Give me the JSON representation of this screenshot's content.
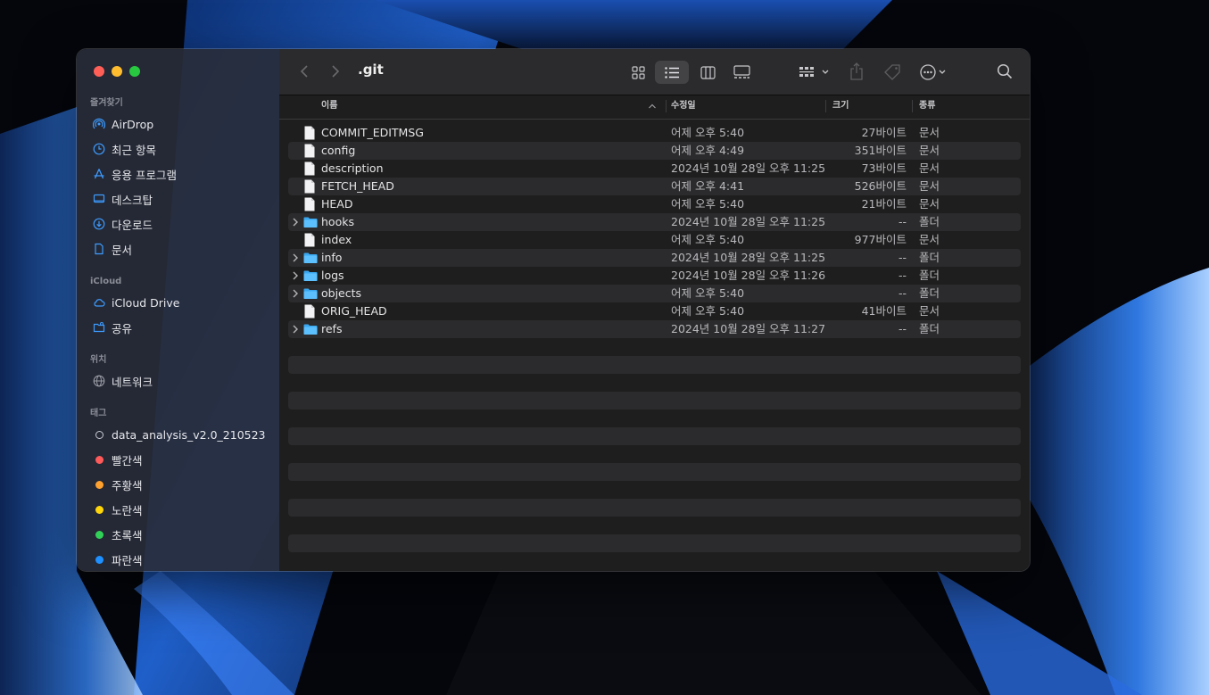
{
  "window": {
    "title": ".git"
  },
  "sidebar": {
    "favorites": {
      "heading": "즐겨찾기",
      "items": [
        {
          "label": "AirDrop",
          "icon": "airdrop-icon"
        },
        {
          "label": "최근 항목",
          "icon": "clock-icon"
        },
        {
          "label": "응용 프로그램",
          "icon": "applications-icon"
        },
        {
          "label": "데스크탑",
          "icon": "desktop-icon"
        },
        {
          "label": "다운로드",
          "icon": "download-icon"
        },
        {
          "label": "문서",
          "icon": "document-icon"
        }
      ]
    },
    "icloud": {
      "heading": "iCloud",
      "items": [
        {
          "label": "iCloud Drive",
          "icon": "cloud-icon"
        },
        {
          "label": "공유",
          "icon": "shared-folder-icon"
        }
      ]
    },
    "locations": {
      "heading": "위치",
      "items": [
        {
          "label": "네트워크",
          "icon": "globe-icon"
        }
      ]
    },
    "tags": {
      "heading": "태그",
      "items": [
        {
          "label": "data_analysis_v2.0_210523",
          "color": "none"
        },
        {
          "label": "빨간색",
          "color": "#ff5a5a"
        },
        {
          "label": "주황색",
          "color": "#ffa12e"
        },
        {
          "label": "노란색",
          "color": "#ffd60a"
        },
        {
          "label": "초록색",
          "color": "#31d158"
        },
        {
          "label": "파란색",
          "color": "#1e90ff"
        }
      ]
    }
  },
  "columns": {
    "name": "이름",
    "date": "수정일",
    "size": "크기",
    "kind": "종류"
  },
  "files": [
    {
      "name": "COMMIT_EDITMSG",
      "date": "어제 오후 5:40",
      "size": "27바이트",
      "kind": "문서",
      "folder": false
    },
    {
      "name": "config",
      "date": "어제 오후 4:49",
      "size": "351바이트",
      "kind": "문서",
      "folder": false
    },
    {
      "name": "description",
      "date": "2024년 10월 28일 오후 11:25",
      "size": "73바이트",
      "kind": "문서",
      "folder": false
    },
    {
      "name": "FETCH_HEAD",
      "date": "어제 오후 4:41",
      "size": "526바이트",
      "kind": "문서",
      "folder": false
    },
    {
      "name": "HEAD",
      "date": "어제 오후 5:40",
      "size": "21바이트",
      "kind": "문서",
      "folder": false
    },
    {
      "name": "hooks",
      "date": "2024년 10월 28일 오후 11:25",
      "size": "--",
      "kind": "폴더",
      "folder": true
    },
    {
      "name": "index",
      "date": "어제 오후 5:40",
      "size": "977바이트",
      "kind": "문서",
      "folder": false
    },
    {
      "name": "info",
      "date": "2024년 10월 28일 오후 11:25",
      "size": "--",
      "kind": "폴더",
      "folder": true
    },
    {
      "name": "logs",
      "date": "2024년 10월 28일 오후 11:26",
      "size": "--",
      "kind": "폴더",
      "folder": true
    },
    {
      "name": "objects",
      "date": "어제 오후 5:40",
      "size": "--",
      "kind": "폴더",
      "folder": true
    },
    {
      "name": "ORIG_HEAD",
      "date": "어제 오후 5:40",
      "size": "41바이트",
      "kind": "문서",
      "folder": false
    },
    {
      "name": "refs",
      "date": "2024년 10월 28일 오후 11:27",
      "size": "--",
      "kind": "폴더",
      "folder": true
    }
  ],
  "toolbar": {
    "icons": [
      "back-icon",
      "forward-icon",
      "icon-view-icon",
      "list-view-icon",
      "column-view-icon",
      "gallery-view-icon",
      "group-icon",
      "share-icon",
      "tag-icon",
      "more-icon",
      "search-icon"
    ],
    "active_view": "list-view"
  }
}
